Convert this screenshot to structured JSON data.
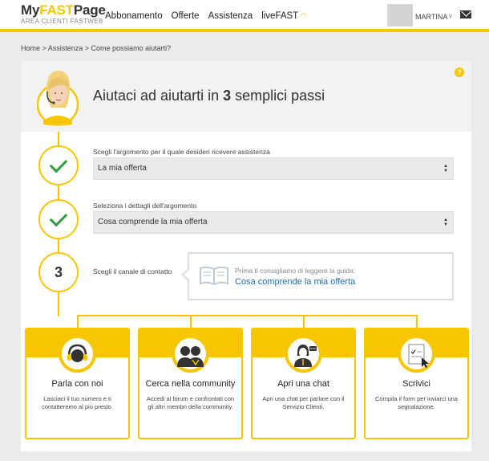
{
  "header": {
    "logo_my": "My",
    "logo_fast": "FAST",
    "logo_page": "Page",
    "logo_sub": "AREA CLIENTI FASTWEB",
    "nav": [
      "Abbonamento",
      "Offerte",
      "Assistenza",
      "liveFAST"
    ],
    "user_name": "MARTINA"
  },
  "breadcrumb": "Home > Assistenza > Come possiamo aiutarti?",
  "hero": {
    "title_before": "Aiutaci ad aiutarti in ",
    "title_num": "3",
    "title_after": " semplici passi",
    "help_icon": "?"
  },
  "steps": [
    {
      "label": "Scegli l'argomento per il quale desideri ricevere assistenza",
      "selected": "La mia offerta",
      "status": "done"
    },
    {
      "label": "Seleziona i dettagli dell'argomento",
      "selected": "Cosa comprende la mia offerta",
      "status": "done"
    },
    {
      "label": "Scegli il canale di contatto",
      "number": "3",
      "status": "current"
    }
  ],
  "guide": {
    "hint": "Prima ti consigliamo di leggere la guida:",
    "link": "Cosa comprende la mia offerta"
  },
  "channels": [
    {
      "title": "Parla con noi",
      "desc": "Lasciaci il tuo numero e ti contatteremo al più presto.",
      "icon": "headset-icon"
    },
    {
      "title": "Cerca nella community",
      "desc": "Accedi al forum e confrontati con gli altri membri della community.",
      "icon": "community-icon"
    },
    {
      "title": "Apri una chat",
      "desc": "Apri una chat per parlare con il Servizio Clienti.",
      "icon": "chat-icon"
    },
    {
      "title": "Scrivici",
      "desc": "Compila il form per inviarci una segnalazione.",
      "icon": "form-icon"
    }
  ],
  "colors": {
    "accent": "#f7c600",
    "check": "#2e9e3e",
    "link": "#1d6fb5"
  }
}
